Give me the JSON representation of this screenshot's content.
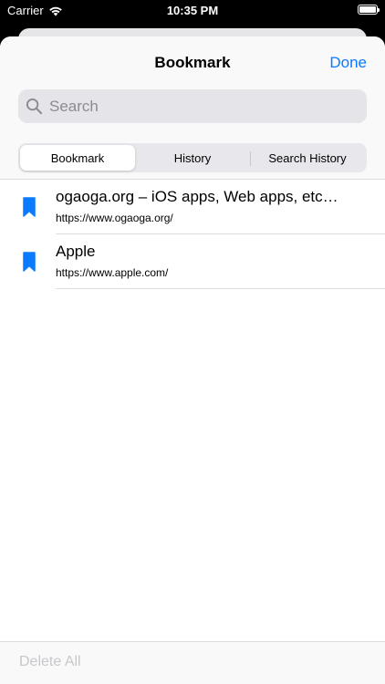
{
  "status_bar": {
    "carrier": "Carrier",
    "time": "10:35 PM",
    "battery_level": 1.0
  },
  "nav": {
    "title": "Bookmark",
    "done_label": "Done"
  },
  "search": {
    "placeholder": "Search",
    "value": ""
  },
  "segments": [
    {
      "label": "Bookmark",
      "selected": true
    },
    {
      "label": "History",
      "selected": false
    },
    {
      "label": "Search History",
      "selected": false
    }
  ],
  "bookmarks": [
    {
      "title": "ogaoga.org – iOS apps, Web apps, etc…",
      "url": "https://www.ogaoga.org/",
      "icon": "bookmark-icon"
    },
    {
      "title": "Apple",
      "url": "https://www.apple.com/",
      "icon": "bookmark-icon"
    }
  ],
  "toolbar": {
    "delete_all_label": "Delete All",
    "delete_all_enabled": false
  },
  "colors": {
    "accent": "#0a7aff",
    "bookmark_icon": "#0a7aff",
    "disabled_text": "#c7c7cc"
  }
}
